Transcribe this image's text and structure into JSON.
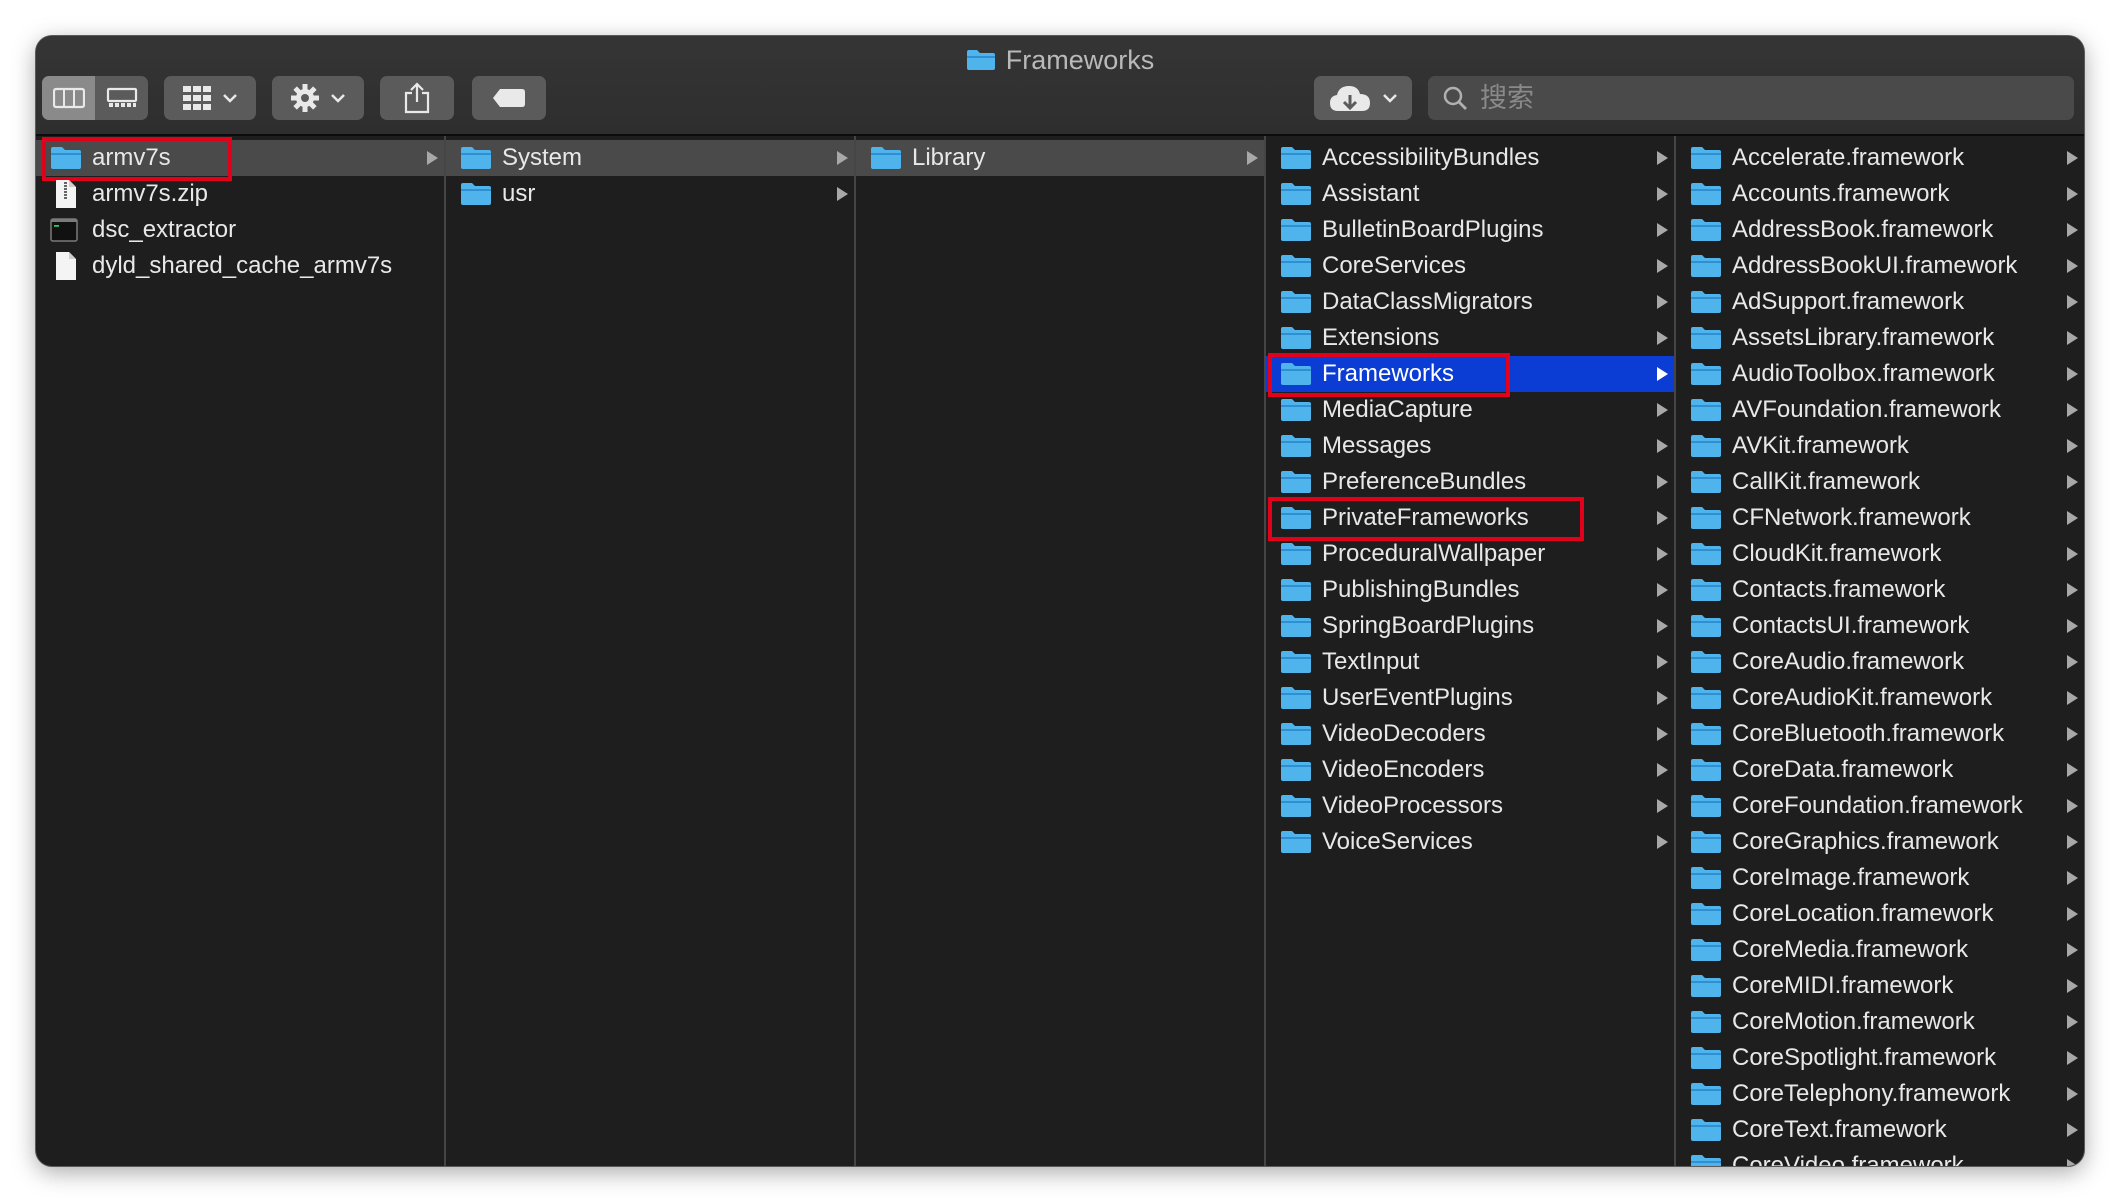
{
  "window": {
    "title": "Frameworks"
  },
  "toolbar": {
    "search": {
      "placeholder": "搜索",
      "value": ""
    },
    "buttons": [
      "column-view",
      "gallery-view",
      "group-by",
      "action",
      "share",
      "tags",
      "icloud"
    ]
  },
  "columns": [
    {
      "items": [
        {
          "name": "armv7s",
          "type": "folder",
          "arrow": true,
          "state": "path",
          "highlight": true
        },
        {
          "name": "armv7s.zip",
          "type": "zip"
        },
        {
          "name": "dsc_extractor",
          "type": "exec"
        },
        {
          "name": "dyld_shared_cache_armv7s",
          "type": "doc"
        }
      ]
    },
    {
      "items": [
        {
          "name": "System",
          "type": "folder",
          "arrow": true,
          "state": "path"
        },
        {
          "name": "usr",
          "type": "folder",
          "arrow": true
        }
      ]
    },
    {
      "items": [
        {
          "name": "Library",
          "type": "folder",
          "arrow": true,
          "state": "path"
        }
      ]
    },
    {
      "items": [
        {
          "name": "AccessibilityBundles",
          "type": "folder",
          "arrow": true
        },
        {
          "name": "Assistant",
          "type": "folder",
          "arrow": true
        },
        {
          "name": "BulletinBoardPlugins",
          "type": "folder",
          "arrow": true
        },
        {
          "name": "CoreServices",
          "type": "folder",
          "arrow": true
        },
        {
          "name": "DataClassMigrators",
          "type": "folder",
          "arrow": true
        },
        {
          "name": "Extensions",
          "type": "folder",
          "arrow": true
        },
        {
          "name": "Frameworks",
          "type": "folder",
          "arrow": true,
          "state": "selected",
          "highlight": true
        },
        {
          "name": "MediaCapture",
          "type": "folder",
          "arrow": true
        },
        {
          "name": "Messages",
          "type": "folder",
          "arrow": true
        },
        {
          "name": "PreferenceBundles",
          "type": "folder",
          "arrow": true
        },
        {
          "name": "PrivateFrameworks",
          "type": "folder",
          "arrow": true,
          "highlight": true
        },
        {
          "name": "ProceduralWallpaper",
          "type": "folder",
          "arrow": true
        },
        {
          "name": "PublishingBundles",
          "type": "folder",
          "arrow": true
        },
        {
          "name": "SpringBoardPlugins",
          "type": "folder",
          "arrow": true
        },
        {
          "name": "TextInput",
          "type": "folder",
          "arrow": true
        },
        {
          "name": "UserEventPlugins",
          "type": "folder",
          "arrow": true
        },
        {
          "name": "VideoDecoders",
          "type": "folder",
          "arrow": true
        },
        {
          "name": "VideoEncoders",
          "type": "folder",
          "arrow": true
        },
        {
          "name": "VideoProcessors",
          "type": "folder",
          "arrow": true
        },
        {
          "name": "VoiceServices",
          "type": "folder",
          "arrow": true
        }
      ]
    },
    {
      "items": [
        {
          "name": "Accelerate.framework",
          "type": "folder",
          "arrow": true
        },
        {
          "name": "Accounts.framework",
          "type": "folder",
          "arrow": true
        },
        {
          "name": "AddressBook.framework",
          "type": "folder",
          "arrow": true
        },
        {
          "name": "AddressBookUI.framework",
          "type": "folder",
          "arrow": true
        },
        {
          "name": "AdSupport.framework",
          "type": "folder",
          "arrow": true
        },
        {
          "name": "AssetsLibrary.framework",
          "type": "folder",
          "arrow": true
        },
        {
          "name": "AudioToolbox.framework",
          "type": "folder",
          "arrow": true
        },
        {
          "name": "AVFoundation.framework",
          "type": "folder",
          "arrow": true
        },
        {
          "name": "AVKit.framework",
          "type": "folder",
          "arrow": true
        },
        {
          "name": "CallKit.framework",
          "type": "folder",
          "arrow": true
        },
        {
          "name": "CFNetwork.framework",
          "type": "folder",
          "arrow": true
        },
        {
          "name": "CloudKit.framework",
          "type": "folder",
          "arrow": true
        },
        {
          "name": "Contacts.framework",
          "type": "folder",
          "arrow": true
        },
        {
          "name": "ContactsUI.framework",
          "type": "folder",
          "arrow": true
        },
        {
          "name": "CoreAudio.framework",
          "type": "folder",
          "arrow": true
        },
        {
          "name": "CoreAudioKit.framework",
          "type": "folder",
          "arrow": true
        },
        {
          "name": "CoreBluetooth.framework",
          "type": "folder",
          "arrow": true
        },
        {
          "name": "CoreData.framework",
          "type": "folder",
          "arrow": true
        },
        {
          "name": "CoreFoundation.framework",
          "type": "folder",
          "arrow": true
        },
        {
          "name": "CoreGraphics.framework",
          "type": "folder",
          "arrow": true
        },
        {
          "name": "CoreImage.framework",
          "type": "folder",
          "arrow": true
        },
        {
          "name": "CoreLocation.framework",
          "type": "folder",
          "arrow": true
        },
        {
          "name": "CoreMedia.framework",
          "type": "folder",
          "arrow": true
        },
        {
          "name": "CoreMIDI.framework",
          "type": "folder",
          "arrow": true
        },
        {
          "name": "CoreMotion.framework",
          "type": "folder",
          "arrow": true
        },
        {
          "name": "CoreSpotlight.framework",
          "type": "folder",
          "arrow": true
        },
        {
          "name": "CoreTelephony.framework",
          "type": "folder",
          "arrow": true
        },
        {
          "name": "CoreText.framework",
          "type": "folder",
          "arrow": true
        },
        {
          "name": "CoreVideo.framework",
          "type": "folder",
          "arrow": true
        }
      ]
    }
  ],
  "colors": {
    "selection": "#0b3cd3",
    "path": "#4a4a4a",
    "folder": "#4fb3ec",
    "highlight": "#e3001b"
  }
}
